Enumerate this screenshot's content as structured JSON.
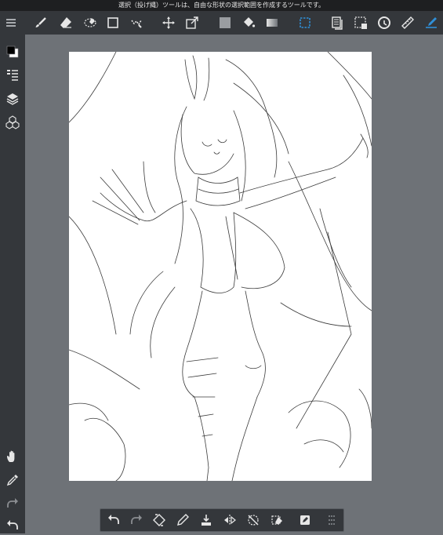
{
  "hint_text": "選択（投げ縄）ツールは、自由な形状の選択範囲を作成するツールです。",
  "colors": {
    "toolbar_bg": "#34373b",
    "workspace_bg": "#6e7277",
    "canvas_bg": "#ffffff",
    "icon": "#e6e6e6",
    "accent_blue": "#2f8fd8"
  },
  "top_toolbar": [
    "menu-icon",
    "brush-icon",
    "eraser-icon",
    "lasso-eraser-icon",
    "rectangle-select-icon",
    "lasso-select-icon",
    "move-icon",
    "transform-icon",
    "fill-color-icon",
    "fill-bucket-icon",
    "gradient-icon",
    "selection-icon",
    "layer-copy-icon",
    "select-layer-icon",
    "redo-circle-icon",
    "ruler-icon",
    "pen-blue-icon"
  ],
  "left_sidebar": [
    "color-swatch-icon",
    "layer-properties-icon",
    "layers-icon",
    "materials-icon",
    "hand-icon",
    "eyedropper-icon",
    "redo-icon",
    "undo-icon"
  ],
  "bottom_bar": [
    "undo-icon",
    "redo-icon",
    "transform-selection-icon",
    "pencil-icon",
    "fill-selection-icon",
    "flip-icon",
    "deselect-icon",
    "clear-icon",
    "edit-icon",
    "more-icon"
  ]
}
